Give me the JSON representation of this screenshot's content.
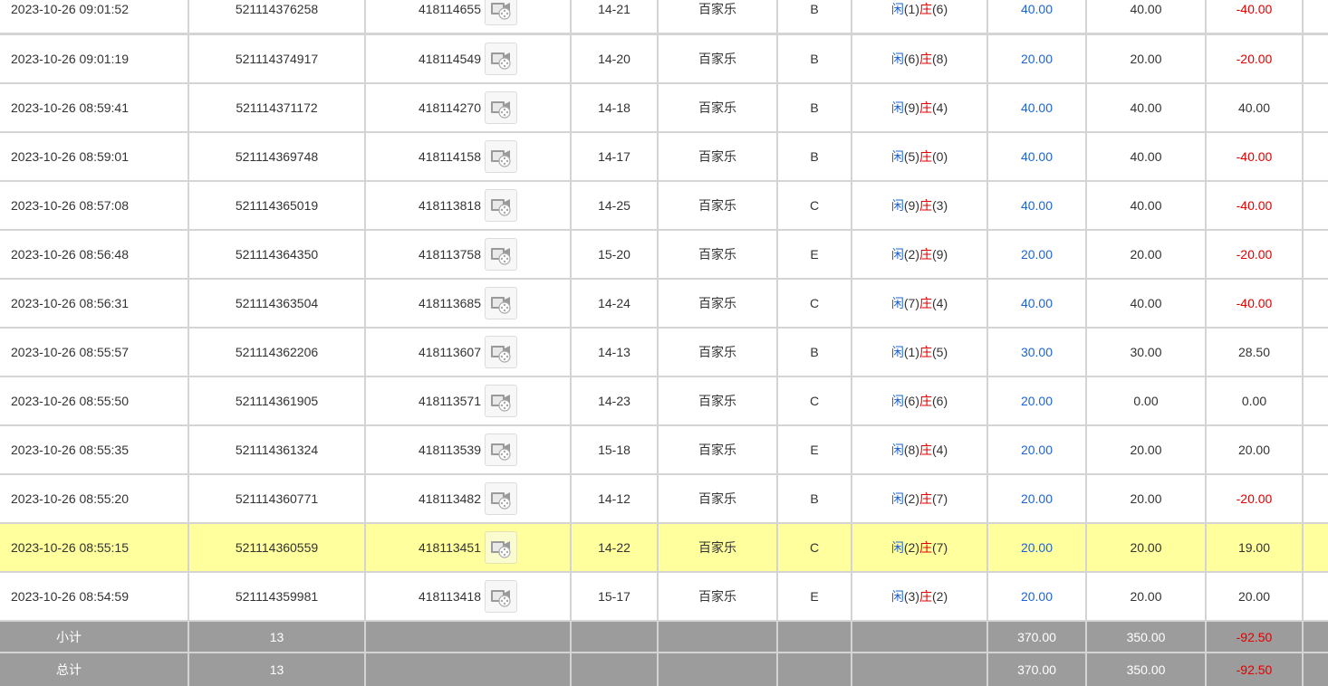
{
  "colors": {
    "player": "#1e64d2",
    "banker": "#e00000",
    "highlight": "#ffff9e",
    "summary_bg": "#9c9c9c"
  },
  "icons": {
    "video": "video-replay-icon"
  },
  "rows": [
    {
      "time": "2023-10-26 09:01:52",
      "bet_no": "521114376258",
      "round_no": "418114655",
      "table": "14-21",
      "game": "百家乐",
      "shoe": "B",
      "player_label": "闲",
      "player_val": "(1)",
      "banker_label": "庄",
      "banker_val": "(6)",
      "bet": "40.00",
      "valid": "40.00",
      "win": "-40.00",
      "win_neg": true
    },
    {
      "time": "2023-10-26 09:01:19",
      "bet_no": "521114374917",
      "round_no": "418114549",
      "table": "14-20",
      "game": "百家乐",
      "shoe": "B",
      "player_label": "闲",
      "player_val": "(6)",
      "banker_label": "庄",
      "banker_val": "(8)",
      "bet": "20.00",
      "valid": "20.00",
      "win": "-20.00",
      "win_neg": true
    },
    {
      "time": "2023-10-26 08:59:41",
      "bet_no": "521114371172",
      "round_no": "418114270",
      "table": "14-18",
      "game": "百家乐",
      "shoe": "B",
      "player_label": "闲",
      "player_val": "(9)",
      "banker_label": "庄",
      "banker_val": "(4)",
      "bet": "40.00",
      "valid": "40.00",
      "win": "40.00",
      "win_neg": false
    },
    {
      "time": "2023-10-26 08:59:01",
      "bet_no": "521114369748",
      "round_no": "418114158",
      "table": "14-17",
      "game": "百家乐",
      "shoe": "B",
      "player_label": "闲",
      "player_val": "(5)",
      "banker_label": "庄",
      "banker_val": "(0)",
      "bet": "40.00",
      "valid": "40.00",
      "win": "-40.00",
      "win_neg": true
    },
    {
      "time": "2023-10-26 08:57:08",
      "bet_no": "521114365019",
      "round_no": "418113818",
      "table": "14-25",
      "game": "百家乐",
      "shoe": "C",
      "player_label": "闲",
      "player_val": "(9)",
      "banker_label": "庄",
      "banker_val": "(3)",
      "bet": "40.00",
      "valid": "40.00",
      "win": "-40.00",
      "win_neg": true
    },
    {
      "time": "2023-10-26 08:56:48",
      "bet_no": "521114364350",
      "round_no": "418113758",
      "table": "15-20",
      "game": "百家乐",
      "shoe": "E",
      "player_label": "闲",
      "player_val": "(2)",
      "banker_label": "庄",
      "banker_val": "(9)",
      "bet": "20.00",
      "valid": "20.00",
      "win": "-20.00",
      "win_neg": true
    },
    {
      "time": "2023-10-26 08:56:31",
      "bet_no": "521114363504",
      "round_no": "418113685",
      "table": "14-24",
      "game": "百家乐",
      "shoe": "C",
      "player_label": "闲",
      "player_val": "(7)",
      "banker_label": "庄",
      "banker_val": "(4)",
      "bet": "40.00",
      "valid": "40.00",
      "win": "-40.00",
      "win_neg": true
    },
    {
      "time": "2023-10-26 08:55:57",
      "bet_no": "521114362206",
      "round_no": "418113607",
      "table": "14-13",
      "game": "百家乐",
      "shoe": "B",
      "player_label": "闲",
      "player_val": "(1)",
      "banker_label": "庄",
      "banker_val": "(5)",
      "bet": "30.00",
      "valid": "30.00",
      "win": "28.50",
      "win_neg": false
    },
    {
      "time": "2023-10-26 08:55:50",
      "bet_no": "521114361905",
      "round_no": "418113571",
      "table": "14-23",
      "game": "百家乐",
      "shoe": "C",
      "player_label": "闲",
      "player_val": "(6)",
      "banker_label": "庄",
      "banker_val": "(6)",
      "bet": "20.00",
      "valid": "0.00",
      "win": "0.00",
      "win_neg": false
    },
    {
      "time": "2023-10-26 08:55:35",
      "bet_no": "521114361324",
      "round_no": "418113539",
      "table": "15-18",
      "game": "百家乐",
      "shoe": "E",
      "player_label": "闲",
      "player_val": "(8)",
      "banker_label": "庄",
      "banker_val": "(4)",
      "bet": "20.00",
      "valid": "20.00",
      "win": "20.00",
      "win_neg": false
    },
    {
      "time": "2023-10-26 08:55:20",
      "bet_no": "521114360771",
      "round_no": "418113482",
      "table": "14-12",
      "game": "百家乐",
      "shoe": "B",
      "player_label": "闲",
      "player_val": "(2)",
      "banker_label": "庄",
      "banker_val": "(7)",
      "bet": "20.00",
      "valid": "20.00",
      "win": "-20.00",
      "win_neg": true
    },
    {
      "time": "2023-10-26 08:55:15",
      "bet_no": "521114360559",
      "round_no": "418113451",
      "table": "14-22",
      "game": "百家乐",
      "shoe": "C",
      "player_label": "闲",
      "player_val": "(2)",
      "banker_label": "庄",
      "banker_val": "(7)",
      "bet": "20.00",
      "valid": "20.00",
      "win": "19.00",
      "win_neg": false,
      "highlighted": true
    },
    {
      "time": "2023-10-26 08:54:59",
      "bet_no": "521114359981",
      "round_no": "418113418",
      "table": "15-17",
      "game": "百家乐",
      "shoe": "E",
      "player_label": "闲",
      "player_val": "(3)",
      "banker_label": "庄",
      "banker_val": "(2)",
      "bet": "20.00",
      "valid": "20.00",
      "win": "20.00",
      "win_neg": false
    }
  ],
  "subtotal": {
    "label": "小计",
    "count": "13",
    "bet": "370.00",
    "valid": "350.00",
    "win": "-92.50"
  },
  "total": {
    "label": "总计",
    "count": "13",
    "bet": "370.00",
    "valid": "350.00",
    "win": "-92.50"
  }
}
